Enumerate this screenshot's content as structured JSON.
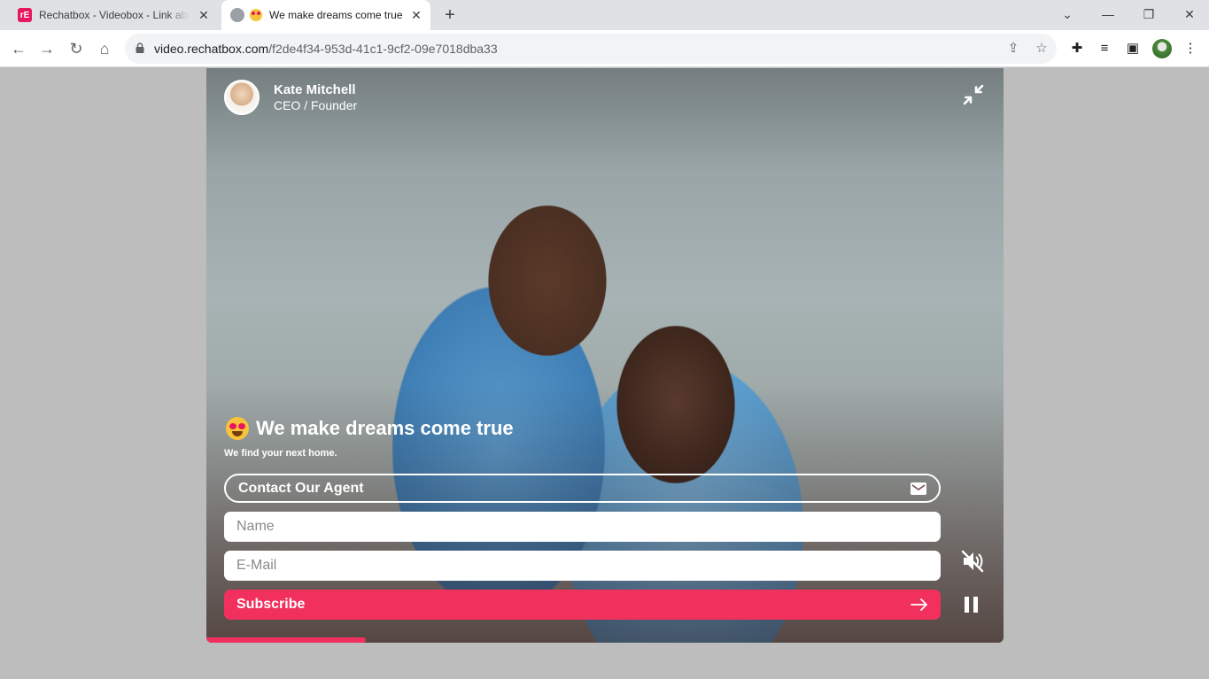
{
  "browser": {
    "tabs": [
      {
        "title": "Rechatbox - Videobox - Link abr",
        "favicon": "rechatbox-logo",
        "active": false
      },
      {
        "title": "We make dreams come true",
        "favicon": "heart-eyes-emoji",
        "active": true
      }
    ],
    "favicon_text": "rE",
    "url_host": "video.rechatbox.com",
    "url_path": "/f2de4f34-953d-41c1-9cf2-09e7018dba33"
  },
  "player": {
    "presenter": {
      "name": "Kate Mitchell",
      "role": "CEO / Founder"
    },
    "headline": "We make dreams come true",
    "subline": "We find your next home.",
    "contact_label": "Contact Our Agent",
    "name_placeholder": "Name",
    "email_placeholder": "E-Mail",
    "subscribe_label": "Subscribe",
    "progress": 0.2,
    "accent_color": "#f2305e",
    "muted": true,
    "playing": true
  }
}
